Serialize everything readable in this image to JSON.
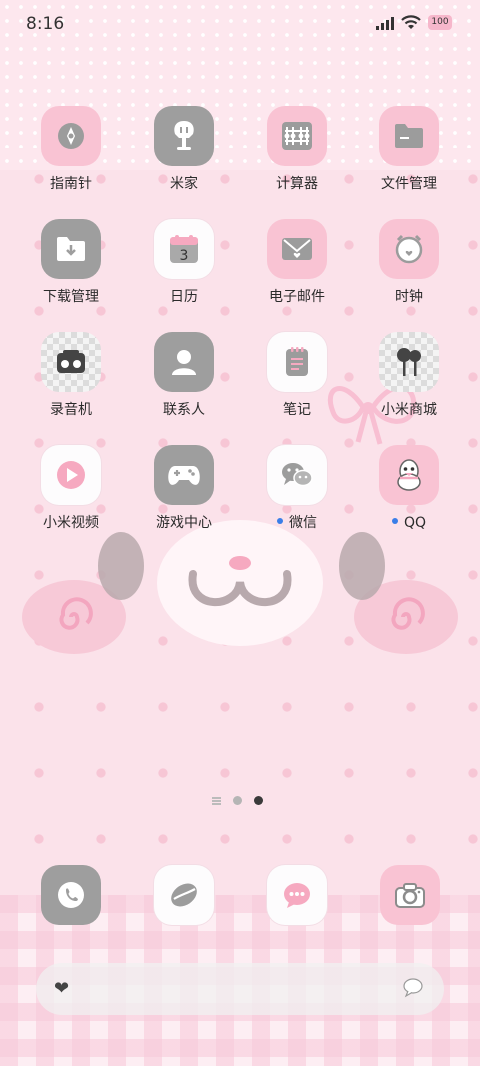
{
  "status_bar": {
    "time": "8:16",
    "battery": "100",
    "icons": [
      "signal-icon",
      "wifi-icon",
      "battery-icon"
    ]
  },
  "apps": [
    {
      "label": "指南针",
      "icon": "compass-icon"
    },
    {
      "label": "米家",
      "icon": "mijia-icon"
    },
    {
      "label": "计算器",
      "icon": "calculator-icon"
    },
    {
      "label": "文件管理",
      "icon": "folder-icon"
    },
    {
      "label": "下载管理",
      "icon": "download-icon"
    },
    {
      "label": "日历",
      "icon": "calendar-icon",
      "day": "3"
    },
    {
      "label": "电子邮件",
      "icon": "mail-icon"
    },
    {
      "label": "时钟",
      "icon": "alarm-clock-icon"
    },
    {
      "label": "录音机",
      "icon": "recorder-icon"
    },
    {
      "label": "联系人",
      "icon": "contacts-icon"
    },
    {
      "label": "笔记",
      "icon": "notes-icon"
    },
    {
      "label": "小米商城",
      "icon": "mi-store-icon"
    },
    {
      "label": "小米视频",
      "icon": "video-play-icon"
    },
    {
      "label": "游戏中心",
      "icon": "gamepad-icon"
    },
    {
      "label": "微信",
      "icon": "wechat-icon",
      "new_dot": true
    },
    {
      "label": "QQ",
      "icon": "qq-penguin-icon",
      "new_dot": true
    }
  ],
  "dock": [
    {
      "icon": "phone-icon"
    },
    {
      "icon": "browser-icon"
    },
    {
      "icon": "messages-icon"
    },
    {
      "icon": "camera-icon"
    }
  ],
  "search_bar": {
    "left_icon": "heart-icon",
    "right_icon": "chat-bubble-icon"
  },
  "colors": {
    "pink_tile": "#f9c3d3",
    "gray_tile": "#9e9e9e",
    "badge_blue": "#3a7ee8",
    "background": "#fbe2ea"
  }
}
